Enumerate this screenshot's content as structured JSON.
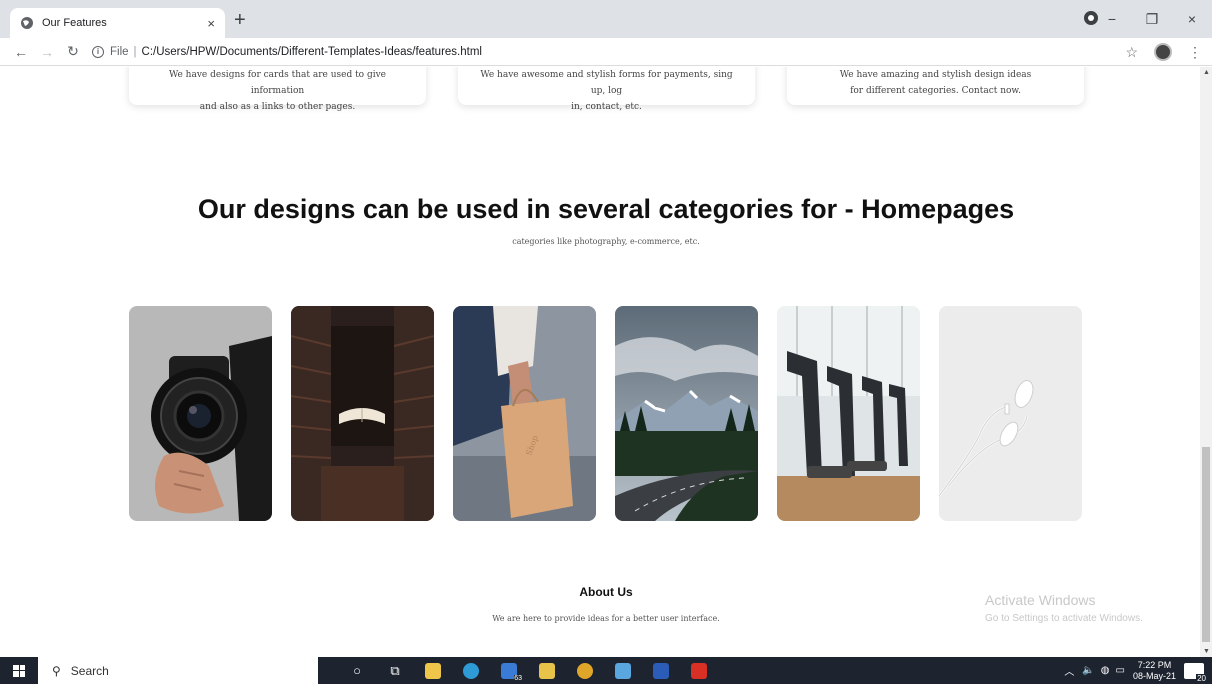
{
  "browser": {
    "tab_title": "Our Features",
    "tab_close": "×",
    "new_tab": "+",
    "url_prefix": "File",
    "url_separator": "|",
    "url": "C:/Users/HPW/Documents/Different-Templates-Ideas/features.html",
    "window_controls": [
      "−",
      "❐",
      "×"
    ]
  },
  "page": {
    "cards": [
      {
        "line1": "We have designs for cards that are used to give information",
        "line2": "and also as a links to other pages."
      },
      {
        "line1": "We have awesome and stylish forms for payments, sing up, log",
        "line2": "in, contact, etc."
      },
      {
        "line1": "We have amazing and stylish design ideas",
        "line2": "for different categories. Contact now."
      }
    ],
    "heading": "Our designs can be used in several categories for - Homepages",
    "subheading": "categories like photography, e-commerce, etc.",
    "gallery": [
      "camera",
      "library",
      "shopping-bag",
      "mountain-road",
      "gym",
      "earphones"
    ],
    "about_title": "About Us",
    "about_text": "We are here to provide ideas for a better user interface."
  },
  "watermark": {
    "title": "Activate Windows",
    "subtitle": "Go to Settings to activate Windows."
  },
  "taskbar": {
    "search_placeholder": "Search",
    "mail_badge": "63",
    "time": "7:22 PM",
    "date": "08-May-21",
    "notifications": "20"
  },
  "colors": {
    "taskbar": "#1d2430",
    "tabstrip": "#dee1e6"
  }
}
